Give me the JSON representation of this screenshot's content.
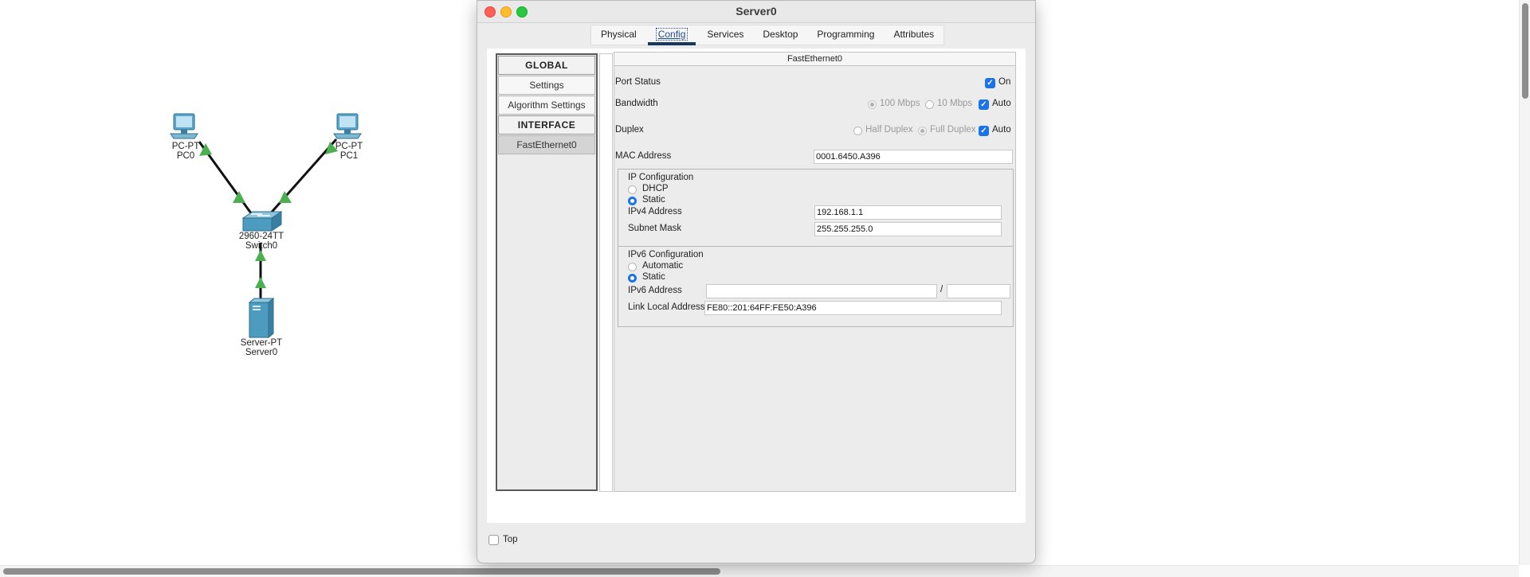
{
  "topology": {
    "pc0": {
      "model": "PC-PT",
      "name": "PC0"
    },
    "pc1": {
      "model": "PC-PT",
      "name": "PC1"
    },
    "switch0": {
      "model": "2960-24TT",
      "name": "Switch0"
    },
    "server0": {
      "model": "Server-PT",
      "name": "Server0"
    },
    "link_color": "#111111",
    "link_up_color": "#4caf50"
  },
  "window": {
    "title": "Server0",
    "tabs": [
      {
        "label": "Physical"
      },
      {
        "label": "Config",
        "active": true
      },
      {
        "label": "Services"
      },
      {
        "label": "Desktop"
      },
      {
        "label": "Programming"
      },
      {
        "label": "Attributes"
      }
    ]
  },
  "nav": {
    "global_header": "GLOBAL",
    "settings": "Settings",
    "algorithm_settings": "Algorithm Settings",
    "interface_header": "INTERFACE",
    "fastethernet0": "FastEthernet0"
  },
  "panel": {
    "title": "FastEthernet0",
    "port_status": {
      "label": "Port Status",
      "on_label": "On",
      "on": true
    },
    "bandwidth": {
      "label": "Bandwidth",
      "opt1": "100 Mbps",
      "opt2": "10 Mbps",
      "auto_label": "Auto",
      "auto": true
    },
    "duplex": {
      "label": "Duplex",
      "opt1": "Half Duplex",
      "opt2": "Full Duplex",
      "auto_label": "Auto",
      "auto": true
    },
    "mac": {
      "label": "MAC Address",
      "value": "0001.6450.A396"
    },
    "ipv4": {
      "group_label": "IP Configuration",
      "dhcp": "DHCP",
      "static": "Static",
      "selected": "Static",
      "address_label": "IPv4 Address",
      "address": "192.168.1.1",
      "mask_label": "Subnet Mask",
      "mask": "255.255.255.0"
    },
    "ipv6": {
      "group_label": "IPv6 Configuration",
      "automatic": "Automatic",
      "static": "Static",
      "selected": "Static",
      "address_label": "IPv6 Address",
      "address": "",
      "prefix_sep": "/",
      "prefix": "",
      "link_local_label": "Link Local Address:",
      "link_local": "FE80::201:64FF:FE50:A396"
    }
  },
  "footer": {
    "top_label": "Top",
    "top_checked": false
  },
  "colors": {
    "accent": "#1a73e8",
    "tab_underline": "#17385f"
  }
}
